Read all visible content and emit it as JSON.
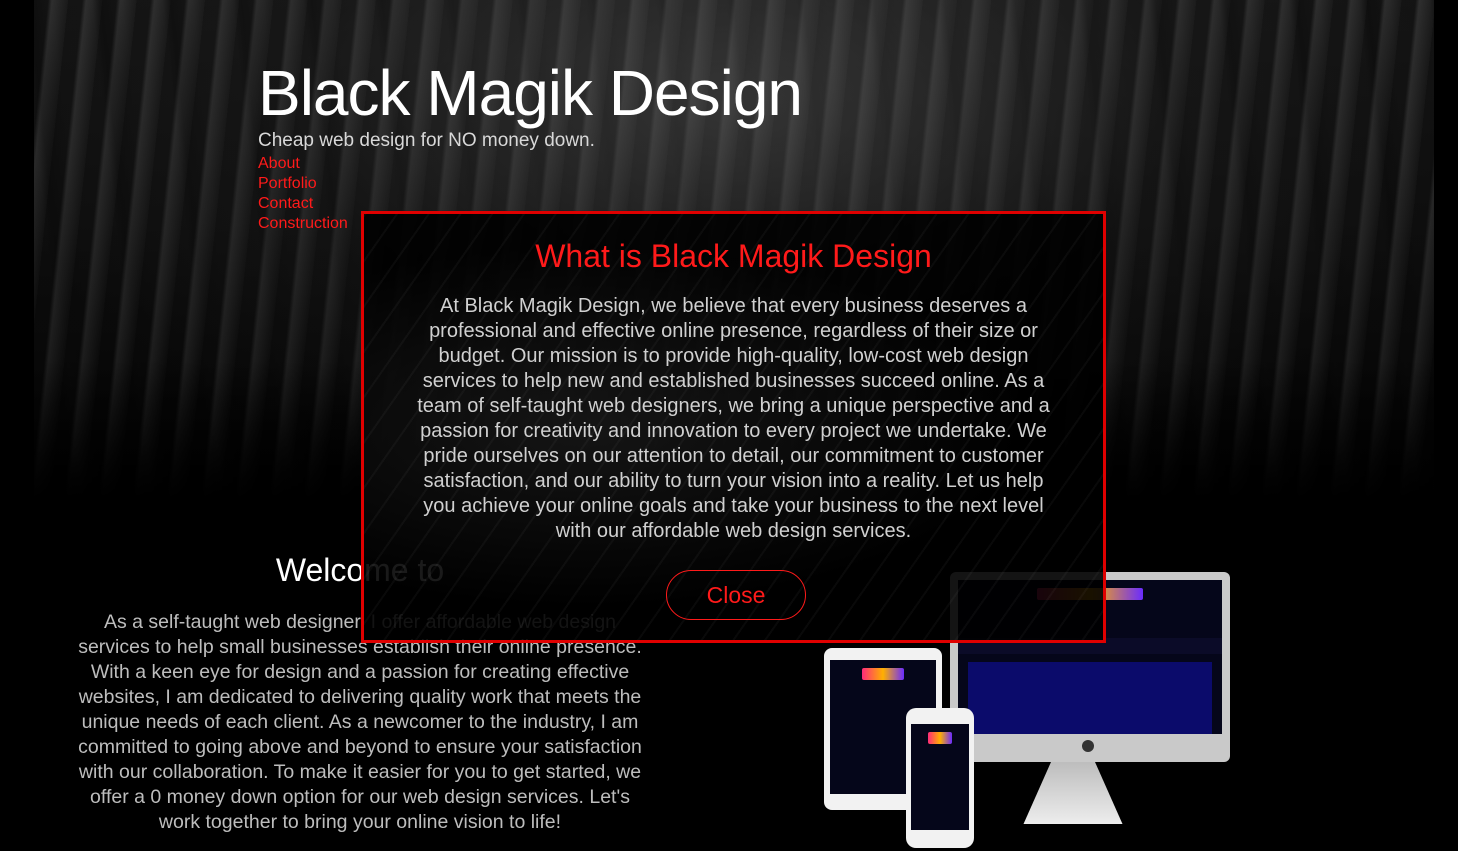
{
  "header": {
    "title": "Black Magik Design",
    "tagline": "Cheap web design for NO money down."
  },
  "nav": {
    "items": [
      {
        "label": "About"
      },
      {
        "label": "Portfolio"
      },
      {
        "label": "Contact"
      },
      {
        "label": "Construction"
      }
    ]
  },
  "welcome": {
    "heading": "Welcome to",
    "text": "As a self-taught web designer, I offer affordable web design services to help small businesses establish their online presence. With a keen eye for design and a passion for creating effective websites, I am dedicated to delivering quality work that meets the unique needs of each client. As a newcomer to the industry, I am committed to going above and beyond to ensure your satisfaction with our collaboration. To make it easier for you to get started, we offer a 0 money down option for our web design services. Let's work together to bring your online vision to life!"
  },
  "modal": {
    "title": "What is Black Magik Design",
    "text": "At Black Magik Design, we believe that every business deserves a professional and effective online presence, regardless of their size or budget. Our mission is to provide high-quality, low-cost web design services to help new and established businesses succeed online. As a team of self-taught web designers, we bring a unique perspective and a passion for creativity and innovation to every project we undertake. We pride ourselves on our attention to detail, our commitment to customer satisfaction, and our ability to turn your vision into a reality. Let us help you achieve your online goals and take your business to the next level with our affordable web design services.",
    "close_label": "Close"
  },
  "colors": {
    "accent": "#ff1a1a",
    "modal_border": "#e00000",
    "background": "#000000"
  },
  "icons": {
    "device_mockup": "responsive-devices-image"
  }
}
